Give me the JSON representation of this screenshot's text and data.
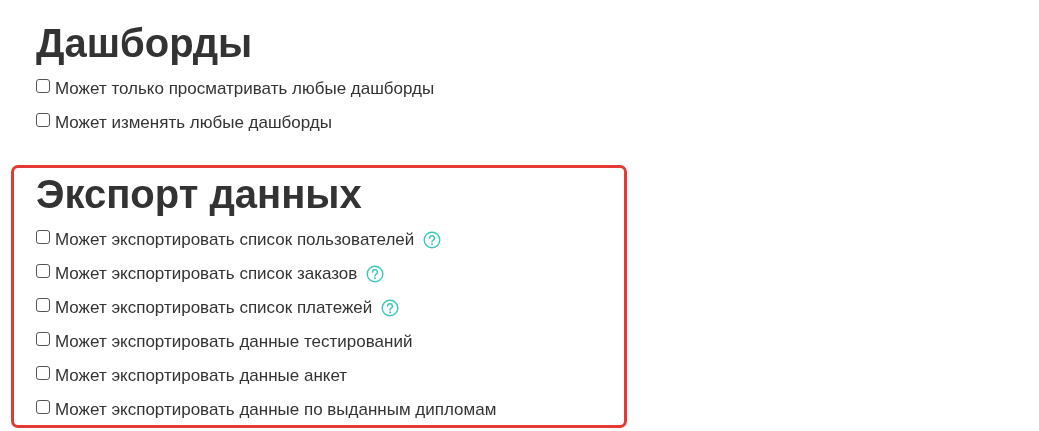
{
  "sections": [
    {
      "title": "Дашборды",
      "highlighted": false,
      "permissions": [
        {
          "label": "Может только просматривать любые дашборды",
          "checked": false,
          "help": false
        },
        {
          "label": "Может изменять любые дашборды",
          "checked": false,
          "help": false
        }
      ]
    },
    {
      "title": "Экспорт данных",
      "highlighted": true,
      "permissions": [
        {
          "label": "Может экспортировать список пользователей",
          "checked": false,
          "help": true
        },
        {
          "label": "Может экспортировать список заказов",
          "checked": false,
          "help": true
        },
        {
          "label": "Может экспортировать список платежей",
          "checked": false,
          "help": true
        },
        {
          "label": "Может экспортировать данные тестирований",
          "checked": false,
          "help": false
        },
        {
          "label": "Может экспортировать данные анкет",
          "checked": false,
          "help": false
        },
        {
          "label": "Может экспортировать данные по выданным дипломам",
          "checked": false,
          "help": false
        }
      ]
    }
  ]
}
